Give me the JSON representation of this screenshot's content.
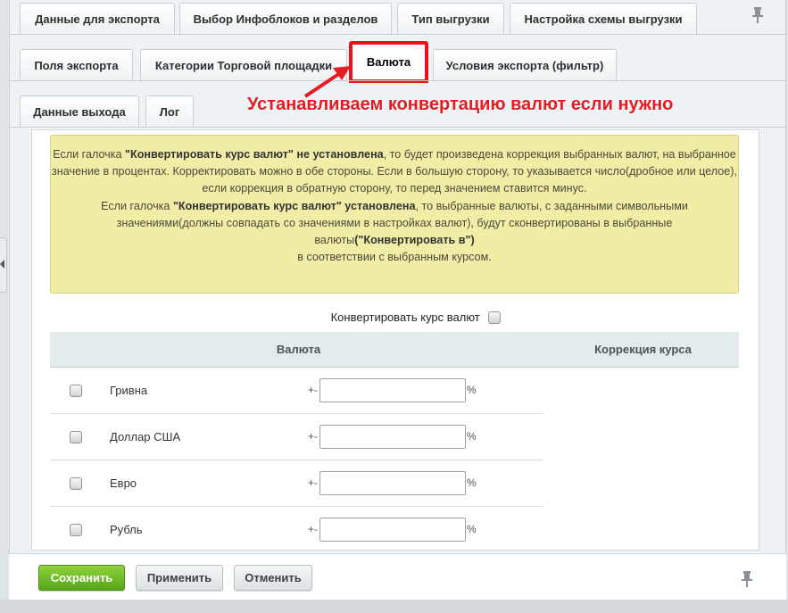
{
  "tabs_row1": [
    "Данные для экспорта",
    "Выбор Инфоблоков и разделов",
    "Тип выгрузки",
    "Настройка схемы выгрузки"
  ],
  "tabs_row2": [
    "Поля экспорта",
    "Категории Торговой площадки",
    "Валюта",
    "Условия экспорта (фильтр)"
  ],
  "tabs_row3": [
    "Данные выхода",
    "Лог"
  ],
  "active_tab": "Валюта",
  "annotation": "Устанавливаем конвертацию валют если нужно",
  "notice": {
    "p1_pre": "Если галочка ",
    "p1_bold": "\"Конвертировать курс валют\" не установлена",
    "p1_post": ", то будет произведена коррекция выбранных валют, на выбранное значение в процентах. Корректировать можно в обе стороны. Если в большую сторону, то указывается число(дробное или целое),",
    "p2": "если коррекция в обратную сторону, то перед значением ставится минус.",
    "p3_pre": "Если галочка ",
    "p3_bold": "\"Конвертировать курс валют\" установлена",
    "p3_post": ", то выбранные валюты, с заданными символьными значениями(должны совпадать со значениями в настройках валют), будут сконвертированы в выбранные валюты",
    "p3_bold2": "(\"Конвертировать в\")",
    "p4": "в соответствии с выбранным курсом."
  },
  "convert_label": "Конвертировать курс валют",
  "table": {
    "col_currency": "Валюта",
    "col_correction": "Коррекция курса",
    "rows": [
      {
        "name": "Гривна",
        "pm": "+-",
        "value": "",
        "pct": "%"
      },
      {
        "name": "Доллар США",
        "pm": "+-",
        "value": "",
        "pct": "%"
      },
      {
        "name": "Евро",
        "pm": "+-",
        "value": "",
        "pct": "%"
      },
      {
        "name": "Рубль",
        "pm": "+-",
        "value": "",
        "pct": "%"
      }
    ]
  },
  "buttons": {
    "save": "Сохранить",
    "apply": "Применить",
    "cancel": "Отменить"
  },
  "colors": {
    "accent_red": "#e31b23",
    "save_green": "#6dbb26",
    "notice_bg": "#f1eda6"
  }
}
